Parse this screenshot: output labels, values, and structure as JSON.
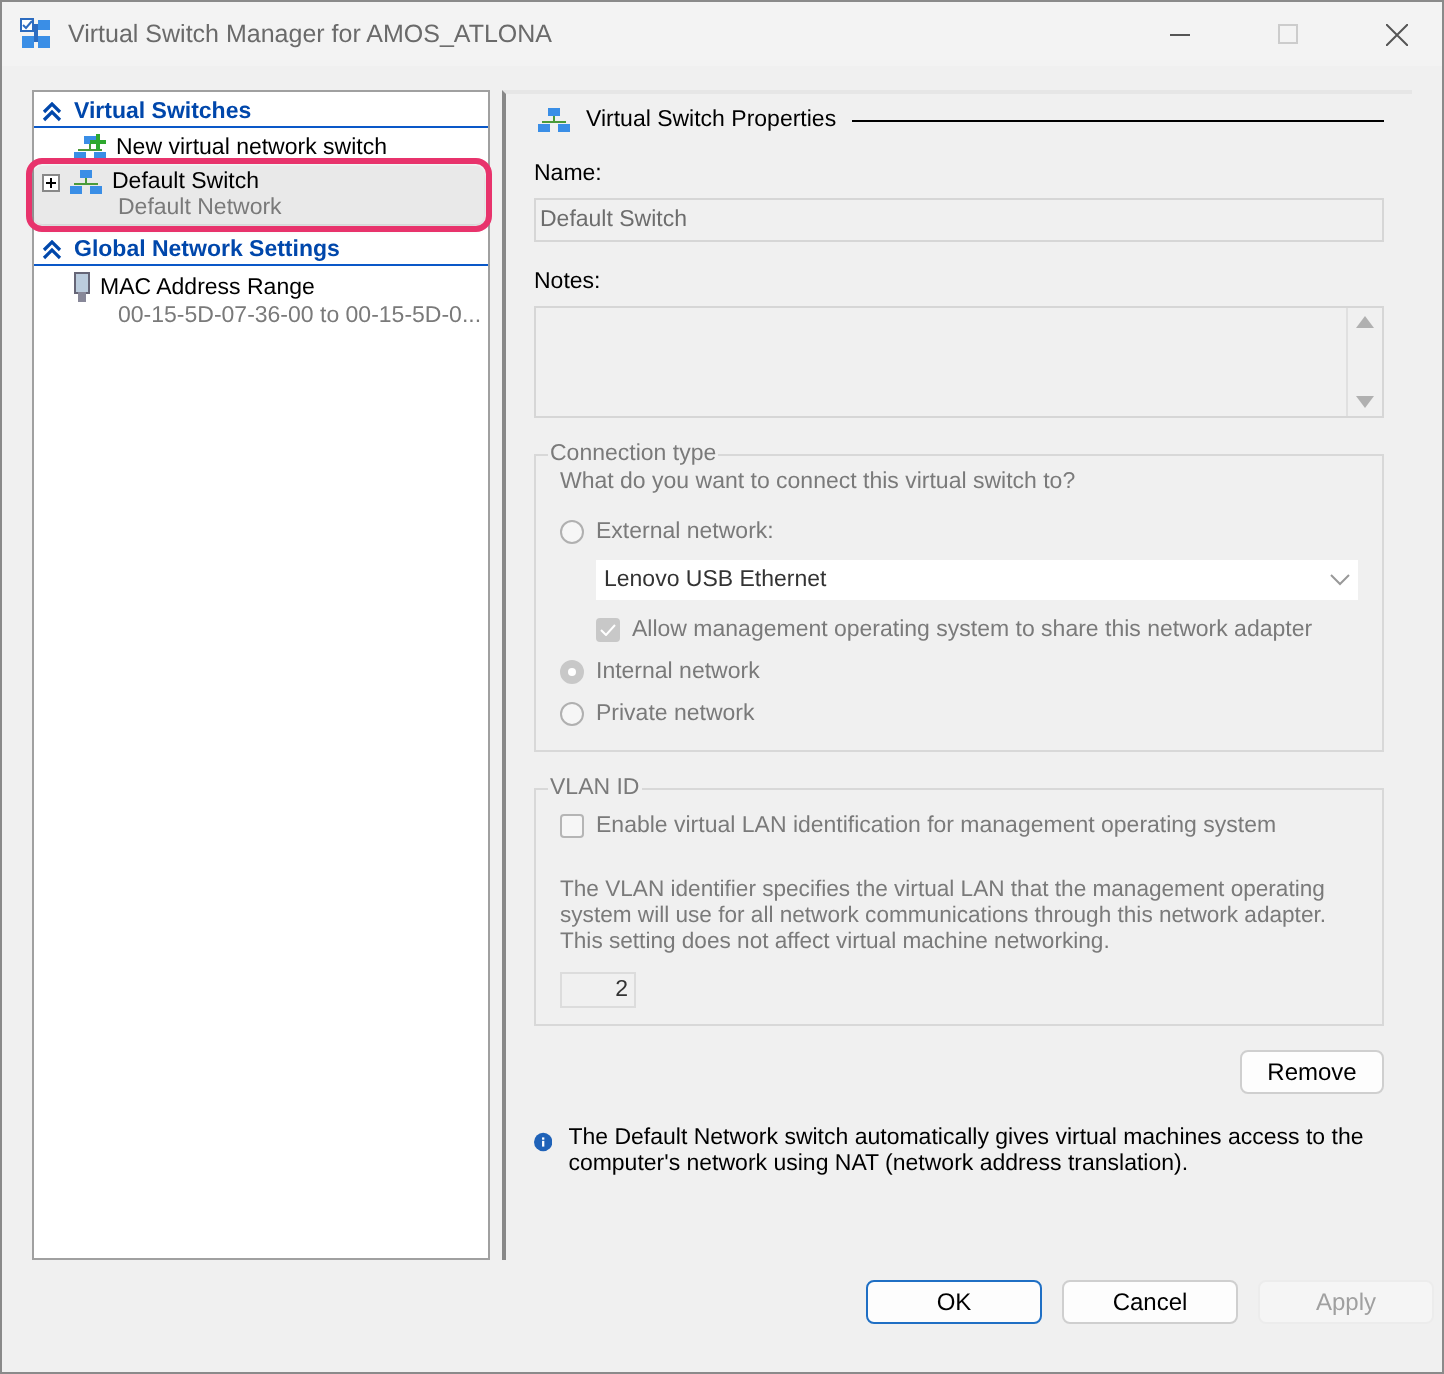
{
  "window": {
    "title": "Virtual Switch Manager for AMOS_ATLONA"
  },
  "sidebar": {
    "sections": [
      {
        "title": "Virtual Switches",
        "expanded": true,
        "items": [
          {
            "kind": "new",
            "label": "New virtual network switch",
            "selected": false
          },
          {
            "kind": "switch",
            "label": "Default Switch",
            "sublabel": "Default Network",
            "expanded": false,
            "selected": true,
            "highlighted": true
          }
        ]
      },
      {
        "title": "Global Network Settings",
        "expanded": true,
        "items": [
          {
            "kind": "mac",
            "label": "MAC Address Range",
            "sublabel": "00-15-5D-07-36-00 to 00-15-5D-0...",
            "selected": false
          }
        ]
      }
    ]
  },
  "properties": {
    "title": "Virtual Switch Properties",
    "name_label": "Name:",
    "name_value": "Default Switch",
    "notes_label": "Notes:",
    "connection": {
      "legend": "Connection type",
      "question": "What do you want to connect this virtual switch to?",
      "options": [
        {
          "label": "External network:",
          "selected": false
        },
        {
          "label": "Internal network",
          "selected": true
        },
        {
          "label": "Private network",
          "selected": false
        }
      ],
      "adapter": "Lenovo USB Ethernet",
      "share": {
        "label": "Allow management operating system to share this network adapter",
        "checked": true
      }
    },
    "vlan": {
      "legend": "VLAN ID",
      "enable": {
        "label": "Enable virtual LAN identification for management operating system",
        "checked": false
      },
      "description": "The VLAN identifier specifies the virtual LAN that the management operating system will use for all network communications through this network adapter. This setting does not affect virtual machine networking.",
      "value": "2"
    },
    "remove_button": "Remove",
    "info": "The Default Network switch automatically gives virtual machines access to the computer's network using NAT (network address translation)."
  },
  "buttons": [
    {
      "label": "OK",
      "default": true,
      "disabled": false
    },
    {
      "label": "Cancel",
      "default": false,
      "disabled": false
    },
    {
      "label": "Apply",
      "default": false,
      "disabled": true
    }
  ]
}
